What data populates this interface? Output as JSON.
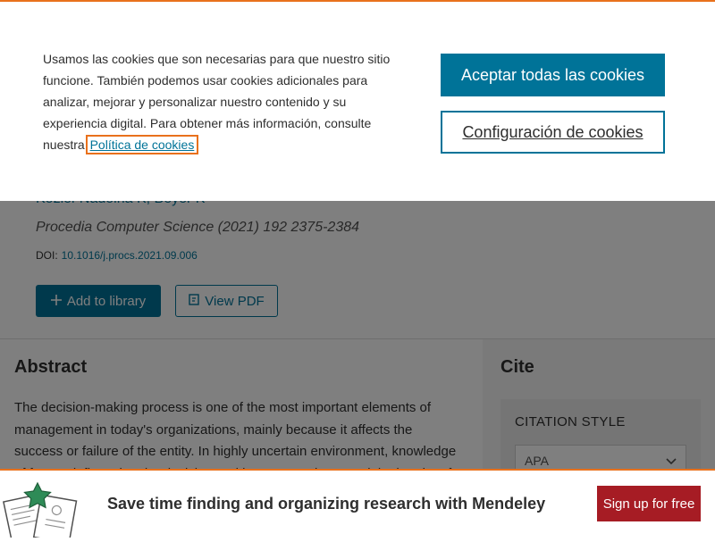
{
  "cookie_banner": {
    "text": "Usamos las cookies que son necesarias para que nuestro sitio funcione. También podemos usar cookies adicionales para analizar, mejorar y personalizar nuestro contenido y su experiencia digital. Para obtener más información, consulte nuestra",
    "policy_link": "Política de cookies",
    "accept_label": "Aceptar todas las cookies",
    "settings_label": "Configuración de cookies"
  },
  "article": {
    "authors": "Koziol-Nadolna K, Beyer K",
    "journal": "Procedia Computer Science (2021) 192 2375-2384",
    "doi_label": "DOI:",
    "doi_value": "10.1016/j.procs.2021.09.006",
    "add_library_label": "Add to library",
    "view_pdf_label": "View PDF"
  },
  "abstract": {
    "heading": "Abstract",
    "text": "The decision-making process is one of the most important elements of management in today's organizations, mainly because it affects the success or failure of the entity. In highly uncertain environment, knowledge of factors influencing the decision-making process is essential. The aim of the"
  },
  "cite": {
    "heading": "Cite",
    "citation_style_label": "CITATION STYLE",
    "selected_style": "APA"
  },
  "mendeley": {
    "promo_text": "Save time finding and organizing research with Mendeley",
    "signup_label": "Sign up for free"
  },
  "icons": {
    "add": "plus-icon",
    "pdf": "pdf-icon",
    "dropdown": "chevron-down-icon",
    "promo": "documents-star-illustration"
  },
  "colors": {
    "accent": "#e9711c",
    "primary": "#007398",
    "signup": "#a61c24"
  }
}
